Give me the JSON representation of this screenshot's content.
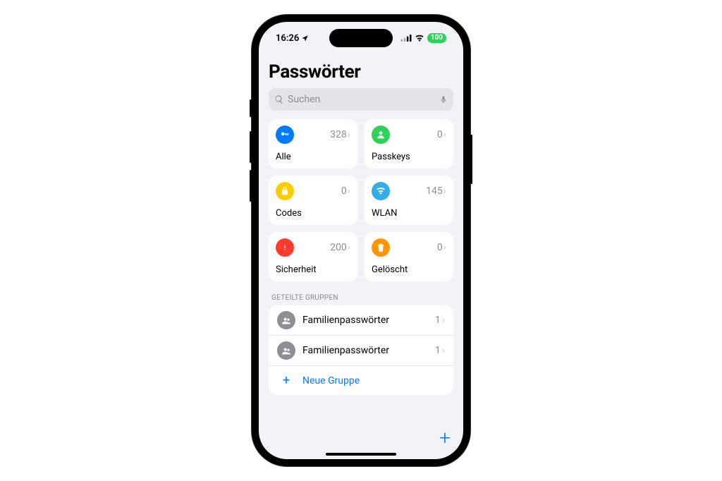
{
  "status": {
    "time": "16:26",
    "battery": "100"
  },
  "page": {
    "title": "Passwörter"
  },
  "search": {
    "placeholder": "Suchen"
  },
  "tiles": [
    {
      "label": "Alle",
      "count": "328",
      "color": "#007aff",
      "icon": "key"
    },
    {
      "label": "Passkeys",
      "count": "0",
      "color": "#30d158",
      "icon": "person"
    },
    {
      "label": "Codes",
      "count": "0",
      "color": "#ffcc00",
      "icon": "lock"
    },
    {
      "label": "WLAN",
      "count": "145",
      "color": "#32ade6",
      "icon": "wifi"
    },
    {
      "label": "Sicherheit",
      "count": "200",
      "color": "#ff3b30",
      "icon": "alert"
    },
    {
      "label": "Gelöscht",
      "count": "0",
      "color": "#ff9500",
      "icon": "trash"
    }
  ],
  "groupsHeader": "GETEILTE GRUPPEN",
  "groups": [
    {
      "label": "Familienpasswörter",
      "count": "1"
    },
    {
      "label": "Familienpasswörter",
      "count": "1"
    }
  ],
  "newGroup": "Neue Gruppe"
}
